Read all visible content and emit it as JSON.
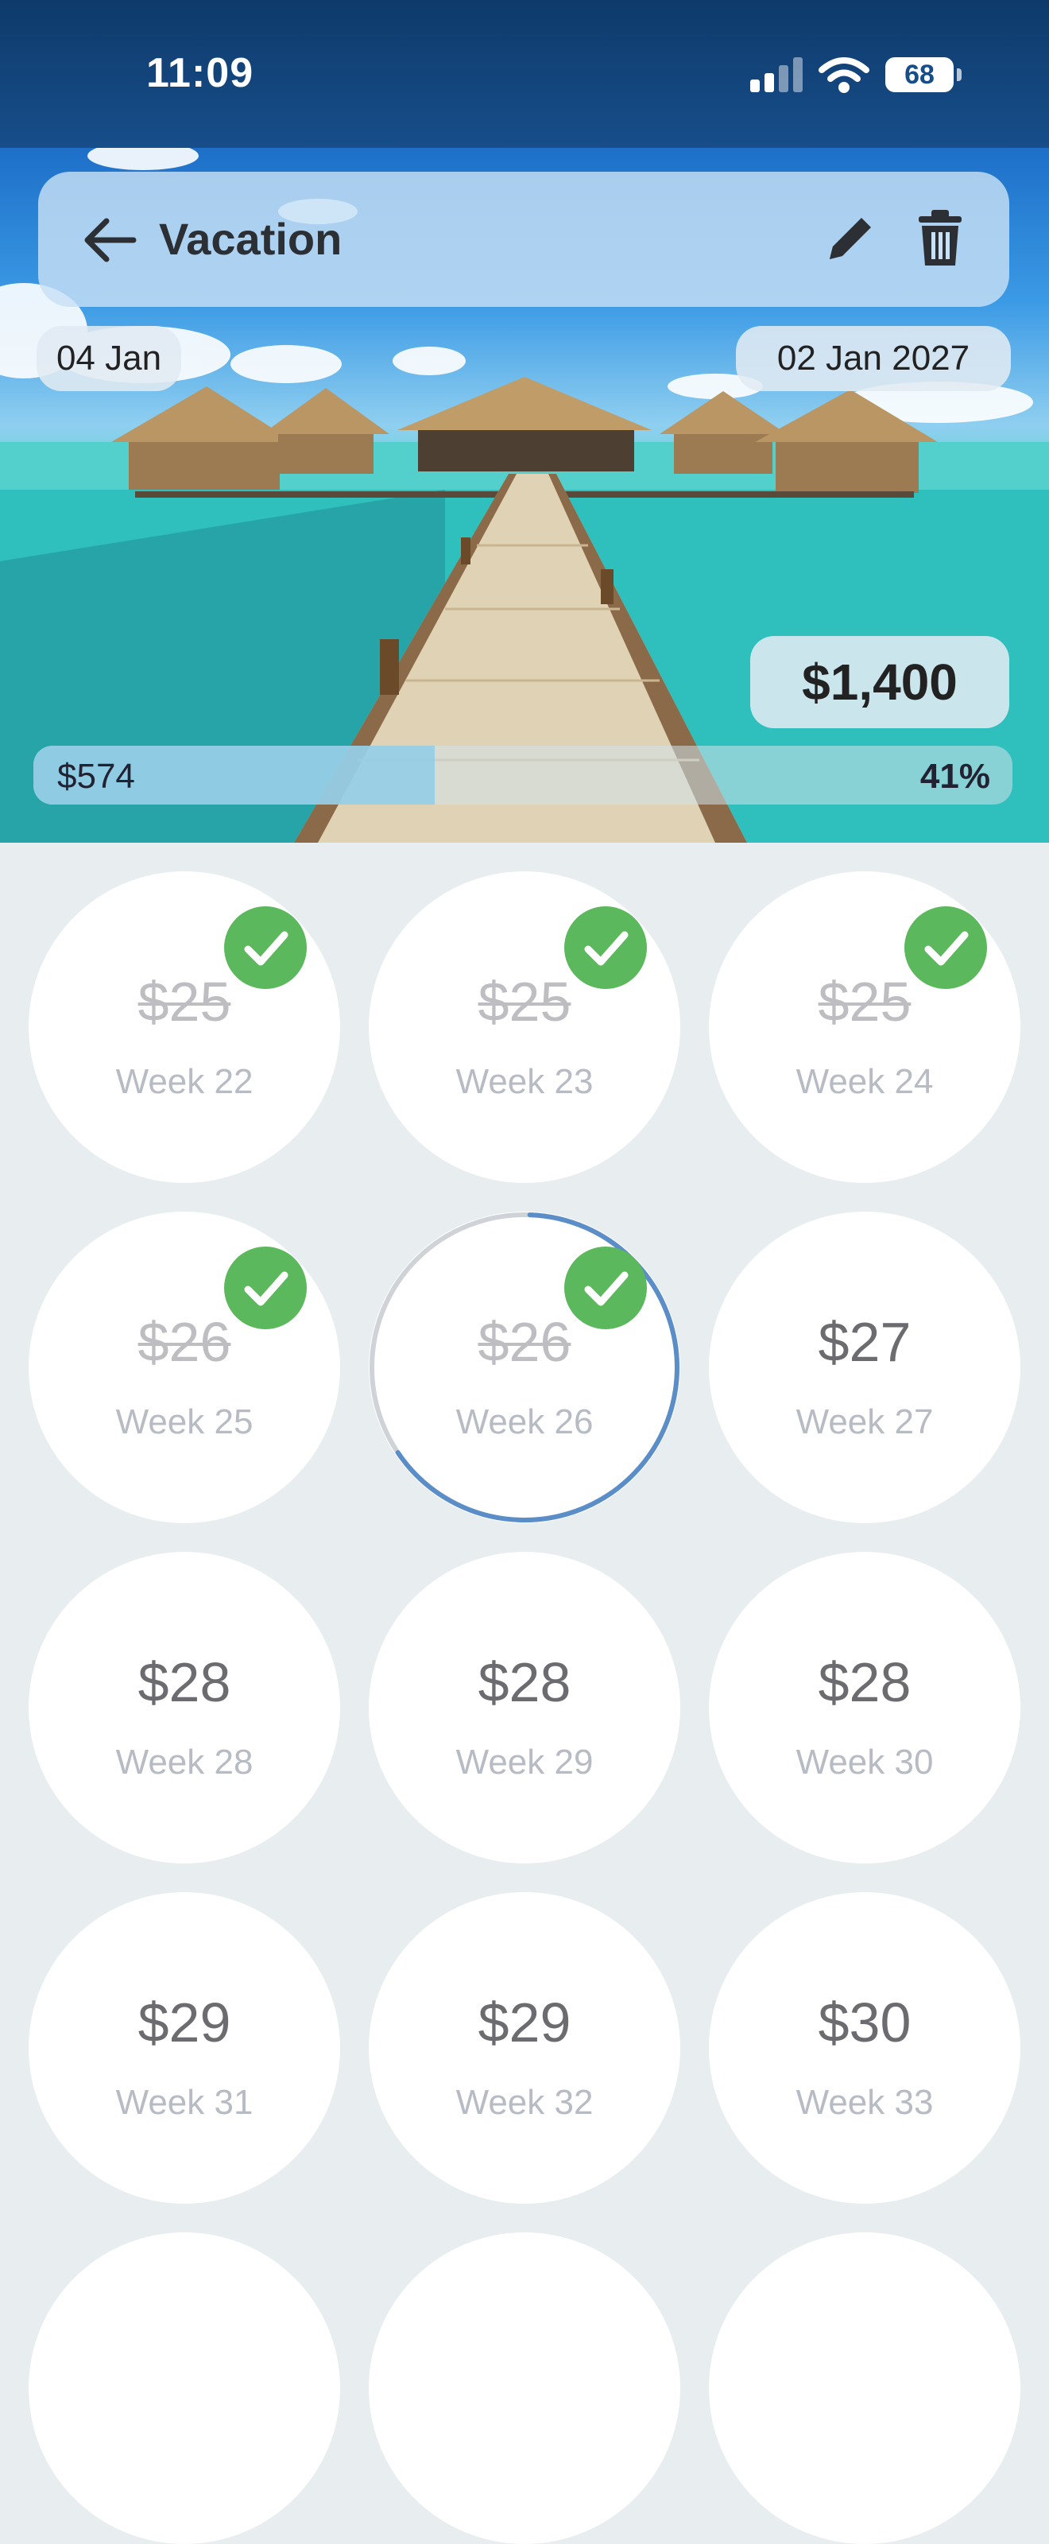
{
  "status": {
    "time": "11:09",
    "battery": "68"
  },
  "header": {
    "title": "Vacation"
  },
  "dates": {
    "start": "04 Jan",
    "end": "02 Jan 2027"
  },
  "goal": {
    "amount": "$1,400",
    "saved": "$574",
    "percent": "41%",
    "progress_fraction": 0.41
  },
  "colors": {
    "check": "#5cb85c",
    "ring_progress": "#5b8ec8",
    "ring_track": "#cfd3d8"
  },
  "weeks": [
    {
      "amount": "$25",
      "label": "Week 22",
      "done": true
    },
    {
      "amount": "$25",
      "label": "Week 23",
      "done": true
    },
    {
      "amount": "$25",
      "label": "Week 24",
      "done": true
    },
    {
      "amount": "$26",
      "label": "Week 25",
      "done": true
    },
    {
      "amount": "$26",
      "label": "Week 26",
      "done": true,
      "current": true,
      "ring_progress": 0.65
    },
    {
      "amount": "$27",
      "label": "Week 27",
      "done": false
    },
    {
      "amount": "$28",
      "label": "Week 28",
      "done": false
    },
    {
      "amount": "$28",
      "label": "Week 29",
      "done": false
    },
    {
      "amount": "$28",
      "label": "Week 30",
      "done": false
    },
    {
      "amount": "$29",
      "label": "Week 31",
      "done": false
    },
    {
      "amount": "$29",
      "label": "Week 32",
      "done": false
    },
    {
      "amount": "$30",
      "label": "Week 33",
      "done": false
    }
  ]
}
